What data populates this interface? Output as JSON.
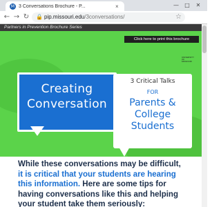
{
  "browser": {
    "tab_title": "3 Conversations Brochure - P...",
    "tab_close": "×",
    "favicon": "M",
    "minimize": "—",
    "maximize": "□",
    "close": "✕",
    "back": "←",
    "forward": "→",
    "reload": "↻",
    "lock": "🔒",
    "url_host": "pip.missouri.edu",
    "url_path": "/3conversations/",
    "star": "☆"
  },
  "page": {
    "series_label": "Partners in Prevention Brochure Series",
    "print_button": "Click here to print this brochure",
    "logo_text": "UNIVERSITY OF MISSOURI",
    "hero_title": "Creating\nConversation",
    "subtitle_line1": "3 Critical Talks",
    "subtitle_line2": "FOR",
    "subtitle_line3": "Parents &\nCollege\nStudents",
    "intro_dark": "While these conversations may be difficult, ",
    "intro_blue": "it is critical that your students are hearing this information.",
    "intro_dark2": " Here are some tips for having conversations like this and helping your student take them seriously:"
  },
  "colors": {
    "hero_green": "#5bd34a",
    "brand_blue": "#1a6fd1",
    "dark_text": "#1d2f4a"
  }
}
